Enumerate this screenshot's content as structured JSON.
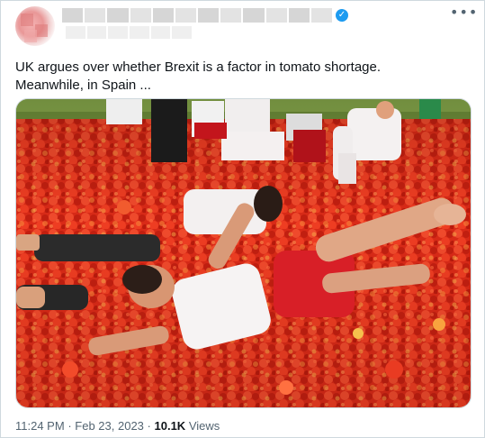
{
  "tweet": {
    "author": {
      "verified_glyph": "✓",
      "avatar_icon": "avatar-pixelated"
    },
    "more_glyph": "•••",
    "text_line1": "UK argues over whether Brexit is a factor in tomato shortage.",
    "text_line2": "Meanwhile, in Spain ...",
    "image_alt": "People in white shirts and red shorts lying in a sea of crushed tomatoes at La Tomatina festival",
    "time": "11:24 PM",
    "sep": "·",
    "date": "Feb 23, 2023",
    "views_count": "10.1K",
    "views_label": "Views",
    "colors": {
      "text": "#0f1419",
      "secondary": "#536471",
      "verified": "#1d9bf0",
      "border": "#cfd9de",
      "tomato": "#e0311f"
    }
  }
}
